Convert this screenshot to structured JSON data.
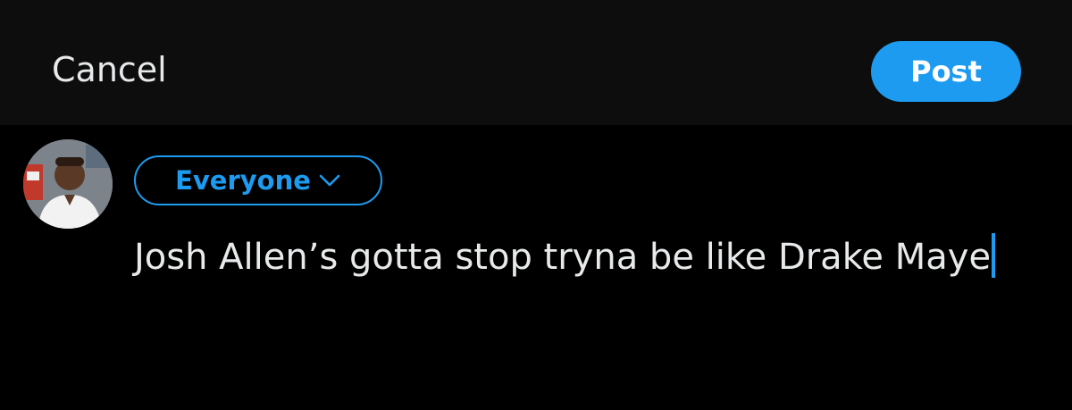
{
  "header": {
    "cancel_label": "Cancel",
    "post_label": "Post"
  },
  "composer": {
    "audience_label": "Everyone",
    "audience_icon": "chevron-down-icon",
    "text": "Josh Allen’s gotta stop tryna be like Drake Maye",
    "avatar_icon": "user-avatar"
  },
  "colors": {
    "accent": "#1d9bf0",
    "background": "#000000",
    "header_background": "#0d0d0d",
    "text": "#e7e9ea"
  }
}
